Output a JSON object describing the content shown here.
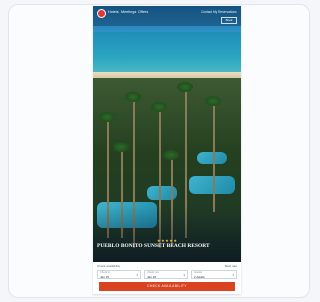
{
  "nav": {
    "links": [
      "Hotels",
      "Meetings",
      "Offers"
    ],
    "right_links": [
      "Contact",
      "My Reservations"
    ],
    "badge": "Book"
  },
  "hero": {
    "rating": "★★★★★",
    "title": "PUEBLO BONITO SUNSET BEACH RESORT"
  },
  "booking": {
    "heading": "Check availability",
    "heading_right": "Best rate",
    "fields": [
      {
        "label": "Check in",
        "value": "Jan 15"
      },
      {
        "label": "Check out",
        "value": "Jan 18"
      },
      {
        "label": "Guests",
        "value": "2 Adults"
      }
    ],
    "button": "CHECK AVAILABILITY"
  }
}
